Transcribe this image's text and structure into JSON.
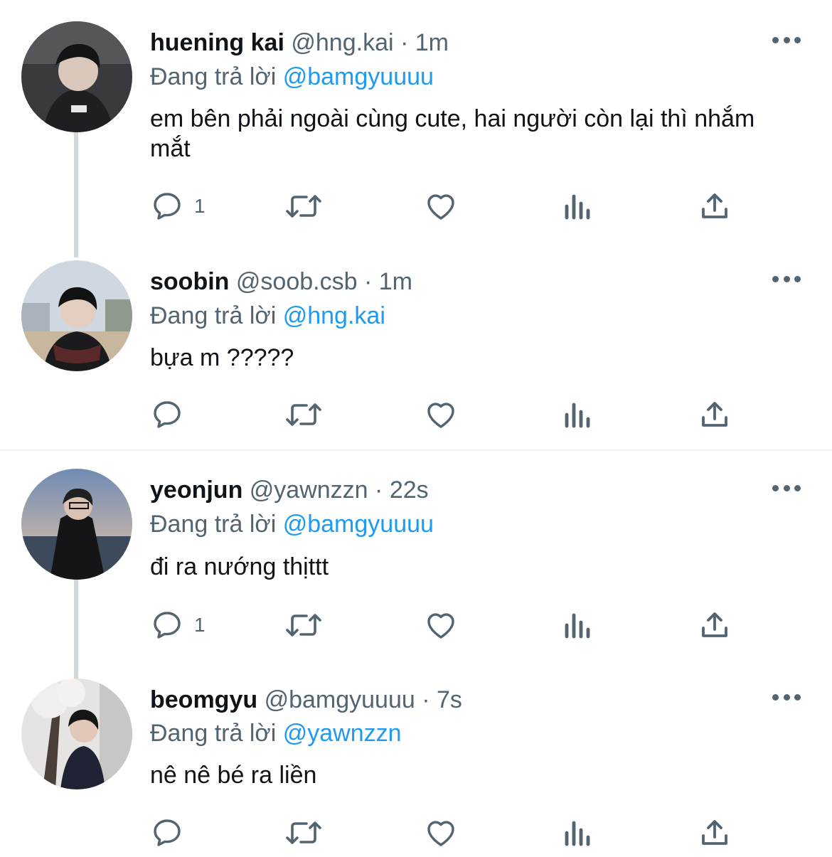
{
  "reply_label": "Đang trả lời",
  "tweets": [
    {
      "name": "huening kai",
      "handle": "@hng.kai",
      "separator": "·",
      "time": "1m",
      "reply_to": "@bamgyuuuu",
      "text": "em bên phải ngoài cùng cute, hai người còn lại thì nhắm mắt",
      "reply_count": "1"
    },
    {
      "name": "soobin",
      "handle": "@soob.csb",
      "separator": "·",
      "time": "1m",
      "reply_to": "@hng.kai",
      "text": "bựa m ?????",
      "reply_count": ""
    },
    {
      "name": "yeonjun",
      "handle": "@yawnzzn",
      "separator": "·",
      "time": "22s",
      "reply_to": "@bamgyuuuu",
      "text": "đi ra nướng thịttt",
      "reply_count": "1"
    },
    {
      "name": "beomgyu",
      "handle": "@bamgyuuuu",
      "separator": "·",
      "time": "7s",
      "reply_to": "@yawnzzn",
      "text": "nê nê bé ra liền",
      "reply_count": ""
    }
  ],
  "colors": {
    "text": "#0f1419",
    "muted": "#536471",
    "link": "#1d9bf0",
    "thread_line": "#cfd9de",
    "divider": "#eff3f4"
  },
  "icons": [
    "reply-icon",
    "retweet-icon",
    "like-icon",
    "views-icon",
    "share-icon",
    "more-icon"
  ]
}
